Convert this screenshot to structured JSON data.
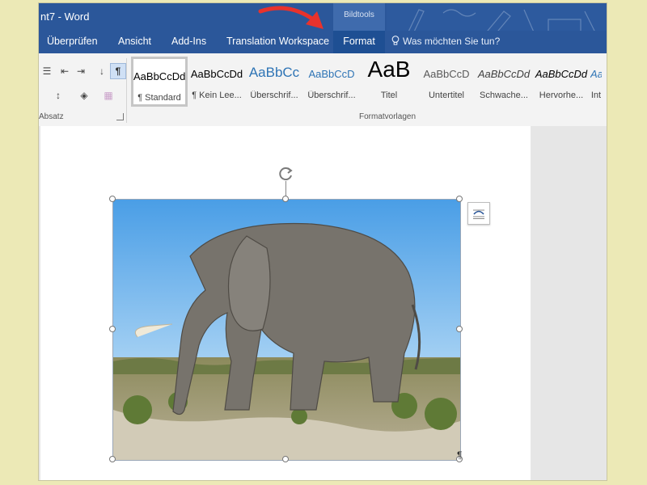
{
  "window": {
    "title": "nt7 - Word",
    "context_group": "Bildtools"
  },
  "tabs": [
    {
      "label": "Überprüfen",
      "active": false
    },
    {
      "label": "Ansicht",
      "active": false
    },
    {
      "label": "Add-Ins",
      "active": false
    },
    {
      "label": "Translation Workspace",
      "active": false
    },
    {
      "label": "Format",
      "active": true
    }
  ],
  "tell_me": {
    "label": "Was möchten Sie tun?",
    "icon": "lightbulb-icon"
  },
  "ribbon": {
    "paragraph_group": {
      "label": "Absatz",
      "buttons": [
        {
          "name": "decrease-indent-icon",
          "glyph": "⇤"
        },
        {
          "name": "increase-indent-icon",
          "glyph": "⇥"
        },
        {
          "name": "sort-icon",
          "glyph": "↓"
        },
        {
          "name": "show-formatting-icon",
          "glyph": "¶"
        },
        {
          "name": "line-spacing-icon",
          "glyph": "↕"
        },
        {
          "name": "shading-icon",
          "glyph": "◈"
        },
        {
          "name": "borders-icon",
          "glyph": "▦"
        }
      ]
    },
    "styles_group": {
      "label": "Formatvorlagen",
      "items": [
        {
          "preview": "AaBbCcDd",
          "name": "¶ Standard",
          "selected": true,
          "color": "#000000"
        },
        {
          "preview": "AaBbCcDd",
          "name": "¶ Kein Lee...",
          "selected": false,
          "color": "#000000"
        },
        {
          "preview": "AaBbCc",
          "name": "Überschrif...",
          "selected": false,
          "color": "#2e74b5"
        },
        {
          "preview": "AaBbCcD",
          "name": "Überschrif...",
          "selected": false,
          "color": "#2e74b5"
        },
        {
          "preview": "AaB",
          "name": "Titel",
          "selected": false,
          "color": "#000000"
        },
        {
          "preview": "AaBbCcD",
          "name": "Untertitel",
          "selected": false,
          "color": "#595959"
        },
        {
          "preview": "AaBbCcDd",
          "name": "Schwache...",
          "selected": false,
          "color": "#404040"
        },
        {
          "preview": "AaBbCcDd",
          "name": "Hervorhe...",
          "selected": false,
          "color": "#000000"
        },
        {
          "preview": "AaBbCcDd",
          "name": "Int",
          "selected": false,
          "color": "#2e74b5"
        }
      ]
    }
  },
  "document": {
    "image_subject": "elephant-photo",
    "paragraph_mark": "¶"
  },
  "colors": {
    "ribbon_blue": "#2b579a",
    "context_tab": "#3f6bad",
    "annotation_arrow": "#e8322c"
  }
}
